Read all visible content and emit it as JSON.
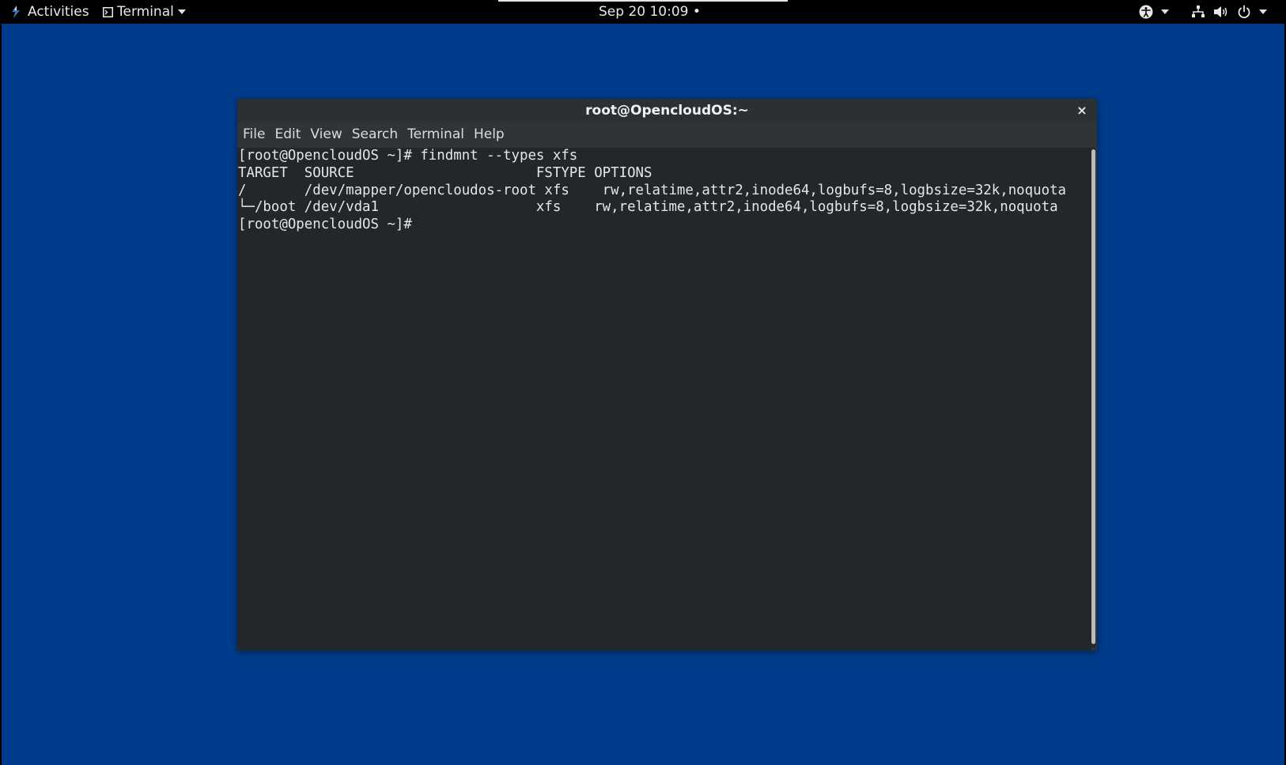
{
  "topbar": {
    "activities_label": "Activities",
    "app_menu_label": "Terminal",
    "clock": "Sep 20  10:09 •"
  },
  "icons": {
    "activities": "fedora-logo-icon",
    "app": "terminal-icon",
    "accessibility": "accessibility-icon",
    "network": "network-icon",
    "volume": "volume-icon",
    "power": "power-icon"
  },
  "colors": {
    "desktop": "#003c8c",
    "topbar": "#000000",
    "terminal_bg": "#232729",
    "titlebar": "#2b3032"
  },
  "window": {
    "title": "root@OpencloudOS:~",
    "close_label": "×",
    "menu": [
      "File",
      "Edit",
      "View",
      "Search",
      "Terminal",
      "Help"
    ]
  },
  "terminal": {
    "lines": [
      "[root@OpencloudOS ~]# findmnt --types xfs",
      "TARGET  SOURCE                      FSTYPE OPTIONS",
      "/       /dev/mapper/opencloudos-root xfs    rw,relatime,attr2,inode64,logbufs=8,logbsize=32k,noquota",
      "└─/boot /dev/vda1                   xfs    rw,relatime,attr2,inode64,logbufs=8,logbsize=32k,noquota",
      "[root@OpencloudOS ~]# "
    ]
  }
}
